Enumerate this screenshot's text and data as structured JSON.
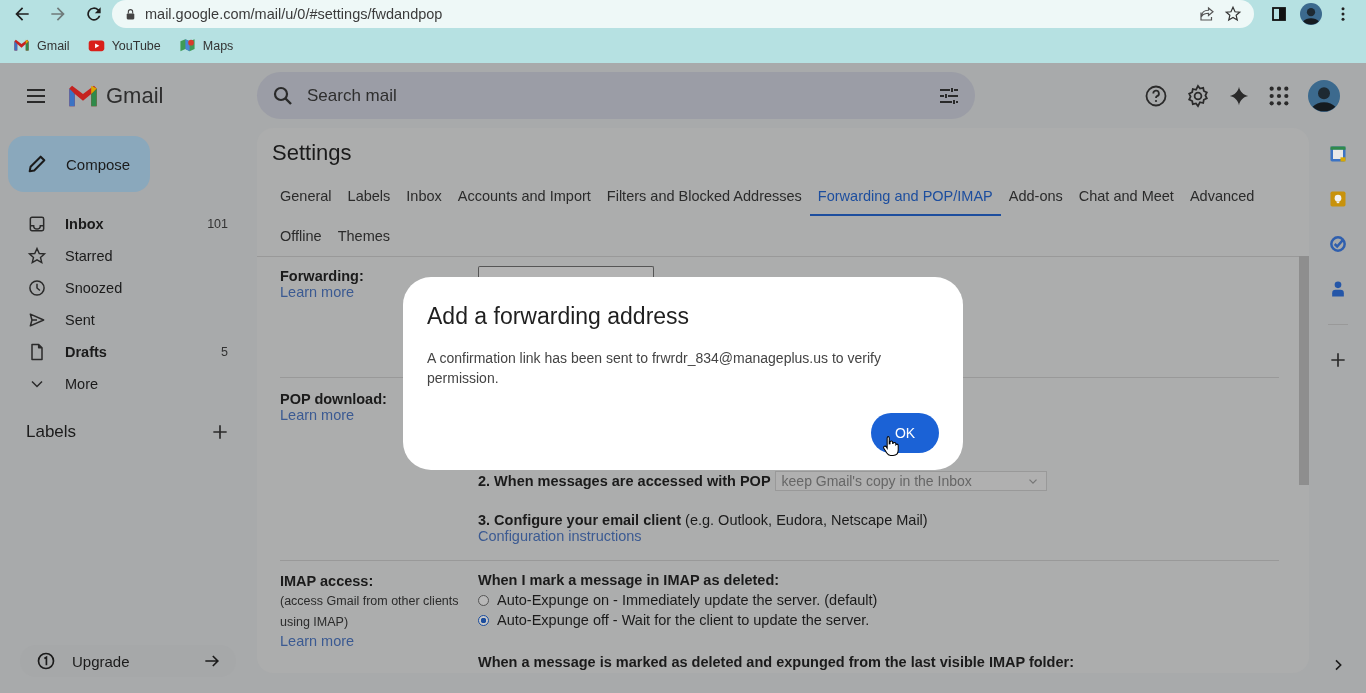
{
  "browser": {
    "url": "mail.google.com/mail/u/0/#settings/fwdandpop",
    "bookmarks": [
      {
        "label": "Gmail",
        "kind": "gmail"
      },
      {
        "label": "YouTube",
        "kind": "youtube"
      },
      {
        "label": "Maps",
        "kind": "maps"
      }
    ]
  },
  "header": {
    "product": "Gmail",
    "search": {
      "placeholder": "Search mail"
    }
  },
  "sidebar": {
    "compose": "Compose",
    "items": [
      {
        "label": "Inbox",
        "count": "101",
        "unread": true,
        "kind": "inbox"
      },
      {
        "label": "Starred",
        "unread": false,
        "kind": "star"
      },
      {
        "label": "Snoozed",
        "unread": false,
        "kind": "clock"
      },
      {
        "label": "Sent",
        "unread": false,
        "kind": "send"
      },
      {
        "label": "Drafts",
        "count": "5",
        "unread": true,
        "kind": "draft"
      },
      {
        "label": "More",
        "unread": false,
        "kind": "more"
      }
    ],
    "labels_heading": "Labels",
    "upgrade": "Upgrade"
  },
  "settings": {
    "title": "Settings",
    "tabs": [
      {
        "label": "General",
        "selected": false
      },
      {
        "label": "Labels",
        "selected": false
      },
      {
        "label": "Inbox",
        "selected": false
      },
      {
        "label": "Accounts and Import",
        "selected": false
      },
      {
        "label": "Filters and Blocked Addresses",
        "selected": false
      },
      {
        "label": "Forwarding and POP/IMAP",
        "selected": true
      },
      {
        "label": "Add-ons",
        "selected": false
      },
      {
        "label": "Chat and Meet",
        "selected": false
      },
      {
        "label": "Advanced",
        "selected": false
      },
      {
        "label": "Offline",
        "selected": false
      },
      {
        "label": "Themes",
        "selected": false
      }
    ],
    "forwarding": {
      "label": "Forwarding:",
      "link": "Learn more"
    },
    "pop": {
      "label": "POP download:",
      "link": "Learn more",
      "step_2": {
        "label": "2. When messages are accessed with POP",
        "select": "keep Gmail's copy in the Inbox"
      },
      "step_3": {
        "text": "**3. Configure your email client** (e.g. Outlook, Eudora, Netscape Mail)",
        "link": "Configuration instructions"
      }
    },
    "imap": {
      "label": "IMAP access:",
      "note": "(access Gmail from other clients using IMAP)",
      "link": "Learn more",
      "question": "When I mark a message in IMAP as deleted:",
      "options": [
        {
          "label": "Auto-Expunge on - Immediately update the server. (default)",
          "selected": false
        },
        {
          "label": "Auto-Expunge off - Wait for the client to update the server.",
          "selected": true
        }
      ],
      "question_2": "When a message is marked as deleted and expunged from the last visible IMAP folder:"
    }
  },
  "dialog": {
    "title": "Add a forwarding address",
    "message": "A confirmation link has been sent to frwrdr_834@manageplus.us to verify permission.",
    "button": "OK"
  }
}
